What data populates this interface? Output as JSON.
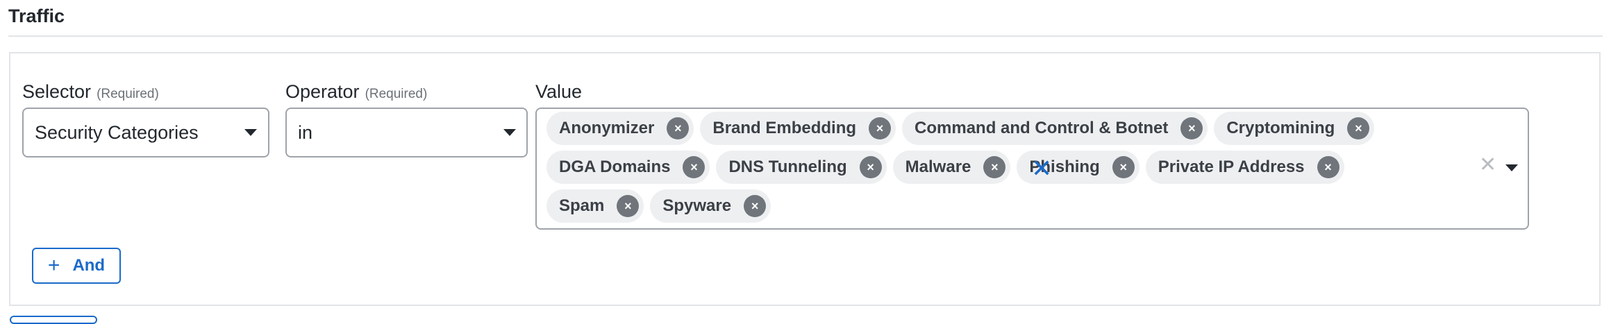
{
  "section": {
    "title": "Traffic"
  },
  "condition": {
    "selector": {
      "label": "Selector",
      "required": "(Required)",
      "value": "Security Categories"
    },
    "operator": {
      "label": "Operator",
      "required": "(Required)",
      "value": "in"
    },
    "value": {
      "label": "Value",
      "tags": [
        "Anonymizer",
        "Brand Embedding",
        "Command and Control & Botnet",
        "Cryptomining",
        "DGA Domains",
        "DNS Tunneling",
        "Malware",
        "Phishing",
        "Private IP Address",
        "Spam",
        "Spyware"
      ],
      "tag_remove_glyph": "×",
      "clear_glyph": "✕"
    },
    "remove_glyph": "✕"
  },
  "and_button": {
    "plus": "+",
    "label": "And"
  },
  "colors": {
    "accent": "#1b6ac9",
    "tag_bg": "#eeeff1",
    "border": "#9ea4aa"
  },
  "icons": [
    "tag-remove-icon",
    "clear-all-icon",
    "chevron-down-icon",
    "close-icon",
    "plus-icon"
  ]
}
